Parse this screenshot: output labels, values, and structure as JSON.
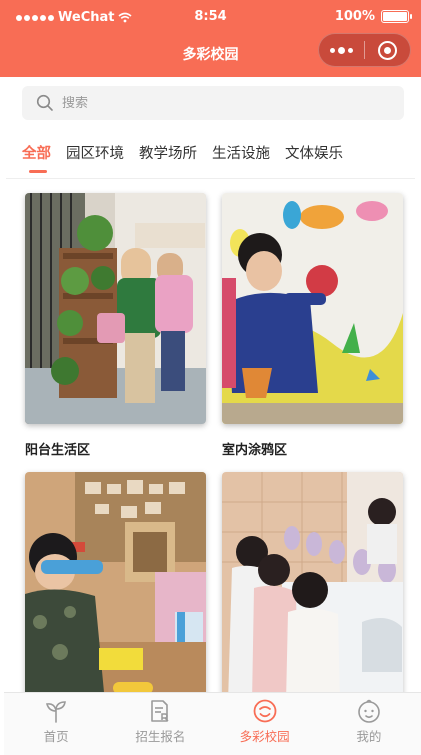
{
  "status_bar": {
    "carrier": "WeChat",
    "time": "8:54",
    "battery": "100%",
    "battery_level": 1.0
  },
  "nav": {
    "title": "多彩校园",
    "more_icon": "more-dots-icon",
    "close_icon": "close-circle-icon"
  },
  "search": {
    "placeholder": "搜索",
    "value": ""
  },
  "tabs": [
    {
      "label": "全部",
      "active": true
    },
    {
      "label": "园区环境",
      "active": false
    },
    {
      "label": "教学场所",
      "active": false
    },
    {
      "label": "生活设施",
      "active": false
    },
    {
      "label": "文体娱乐",
      "active": false
    }
  ],
  "gallery": [
    {
      "title": "阳台生活区"
    },
    {
      "title": "室内涂鸦区"
    },
    {
      "title": ""
    },
    {
      "title": ""
    }
  ],
  "tabbar": [
    {
      "label": "首页",
      "icon": "sprout-icon",
      "active": false
    },
    {
      "label": "招生报名",
      "icon": "form-icon",
      "active": false
    },
    {
      "label": "多彩校园",
      "icon": "face-icon",
      "active": true
    },
    {
      "label": "我的",
      "icon": "baby-face-icon",
      "active": false
    }
  ],
  "colors": {
    "accent": "#f86d55",
    "inactive": "#9a9a9a"
  }
}
